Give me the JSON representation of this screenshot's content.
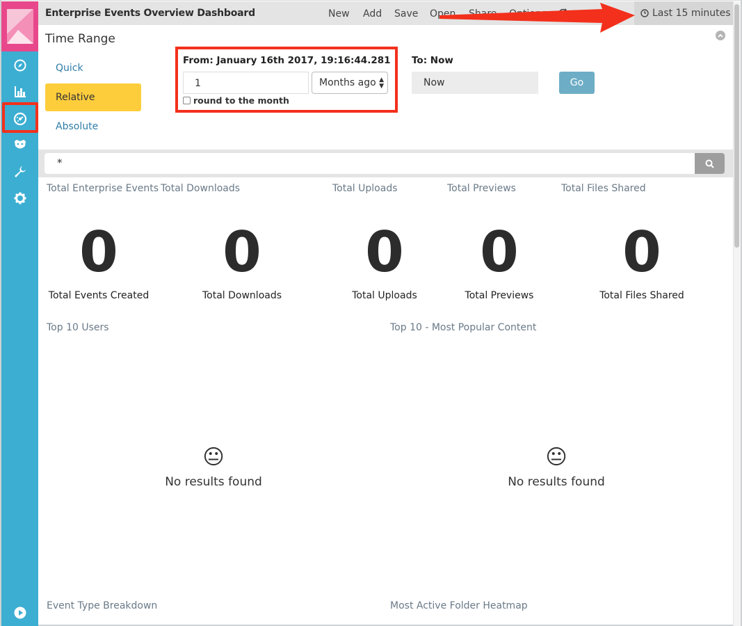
{
  "header": {
    "title": "Enterprise Events Overview Dashboard",
    "nav": [
      "New",
      "Add",
      "Save",
      "Open",
      "Share",
      "Options"
    ],
    "time_label": "Last 15 minutes"
  },
  "time_range": {
    "title": "Time Range",
    "tabs": [
      "Quick",
      "Relative",
      "Absolute"
    ],
    "active_tab": "Relative",
    "from_label": "From: January 16th 2017, 19:16:44.281",
    "from_value": "1",
    "from_unit": "Months ago",
    "round_label": "round to the month",
    "to_label": "To: Now",
    "to_value": "Now",
    "go_label": "Go"
  },
  "query": {
    "value": "*"
  },
  "metrics": [
    {
      "title": "Total Enterprise Events",
      "value": "0",
      "label": "Total Events Created"
    },
    {
      "title": "Total Downloads",
      "value": "0",
      "label": "Total Downloads"
    },
    {
      "title": "Total Uploads",
      "value": "0",
      "label": "Total Uploads"
    },
    {
      "title": "Total Previews",
      "value": "0",
      "label": "Total Previews"
    },
    {
      "title": "Total Files Shared",
      "value": "0",
      "label": "Total Files Shared"
    }
  ],
  "panels": {
    "top_users": {
      "title": "Top 10 Users",
      "message": "No results found"
    },
    "popular_content": {
      "title": "Top 10 - Most Popular Content",
      "message": "No results found"
    },
    "event_breakdown": {
      "title": "Event Type Breakdown"
    },
    "folder_heatmap": {
      "title": "Most Active Folder Heatmap"
    }
  },
  "colors": {
    "sidebar": "#3caed2",
    "logo": "#e8488b",
    "active_tab": "#fecd3c",
    "go_button": "#6eadc6",
    "highlight": "#f3301c"
  },
  "sidebar_icons": [
    "discover-icon",
    "visualize-icon",
    "dashboard-icon",
    "timelion-icon",
    "dev-tools-icon",
    "settings-icon",
    "collapse-play-icon"
  ]
}
